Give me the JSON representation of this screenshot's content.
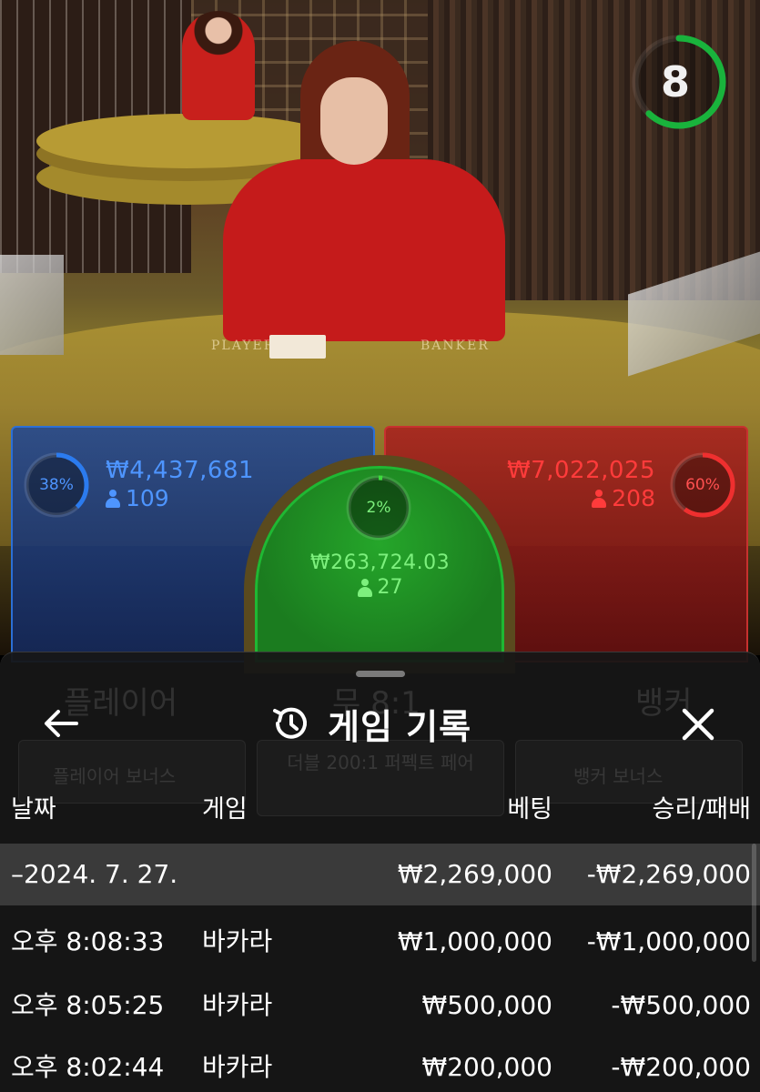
{
  "timer": {
    "seconds_left": "8",
    "fraction_remaining": 0.62,
    "color": "#19b33c"
  },
  "table_labels": {
    "player": "PLAYER",
    "banker": "BANKER"
  },
  "bets": {
    "player": {
      "percent": "38%",
      "fraction": 0.38,
      "amount": "₩4,437,681",
      "players": "109",
      "color": "#2b6fd6"
    },
    "tie": {
      "percent": "2%",
      "fraction": 0.02,
      "amount": "₩263,724.03",
      "players": "27",
      "color": "#1fb833"
    },
    "banker": {
      "percent": "60%",
      "fraction": 0.6,
      "amount": "₩7,022,025",
      "players": "208",
      "color": "#c7312f"
    }
  },
  "background_labels": {
    "player": "플레이어",
    "tie": "무 8:1",
    "banker": "뱅커",
    "player_bonus": "플레이어 보너스",
    "either_pair": "더블 200:1 퍼펙트 페어",
    "banker_bonus": "뱅커 보너스"
  },
  "history": {
    "title": "게임 기록",
    "back_icon": "arrow-left-icon",
    "history_icon": "history-clock-icon",
    "close_icon": "close-x-icon",
    "columns": {
      "date": "날짜",
      "game": "게임",
      "bet": "베팅",
      "win_loss": "승리/패배"
    },
    "group": {
      "date": "–2024. 7. 27.",
      "bet": "₩2,269,000",
      "win_loss": "-₩2,269,000"
    },
    "rows": [
      {
        "time": "오후 8:08:33",
        "game": "바카라",
        "bet": "₩1,000,000",
        "win_loss": "-₩1,000,000"
      },
      {
        "time": "오후 8:05:25",
        "game": "바카라",
        "bet": "₩500,000",
        "win_loss": "-₩500,000"
      },
      {
        "time": "오후 8:02:44",
        "game": "바카라",
        "bet": "₩200,000",
        "win_loss": "-₩200,000"
      }
    ]
  }
}
